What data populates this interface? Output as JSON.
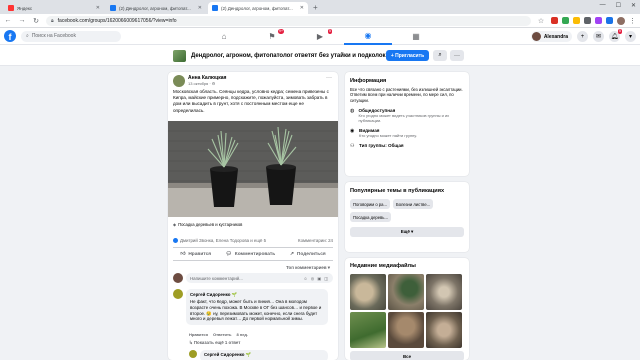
{
  "browser": {
    "tabs": [
      {
        "label": "Яндекс",
        "active": false
      },
      {
        "label": "(2) Дендролог, агроном, фитопат...",
        "active": false
      },
      {
        "label": "(2) Дендролог, агроном, фитопат...",
        "active": true
      }
    ],
    "url": "facebook.com/groups/1620066009617056/?view=info"
  },
  "fb": {
    "search_placeholder": "Поиск на Facebook",
    "user_name": "Alexandra",
    "badges": {
      "pages": "9+",
      "groups": "5",
      "notifications": "5"
    }
  },
  "group": {
    "name": "Дендролог, агроном, фитопатолог ответят без утайки и подколок.",
    "invite_label": "+ Пригласить"
  },
  "post": {
    "author": "Анна Калюцкая",
    "date": "13 октября · ⚙",
    "text": "Московская область. Сеянцы кедра, условно кедра; семена привезены с Кипра, майские примерно, подскажите, пожалуйста, зимовать забрать в дом или высадить в грунт, хотя с постоянным местом еще не определилась.",
    "tag": "Посадка деревьев и кустарников",
    "reactions_text": "Дмитрий Звонка, Елена Тодорова и ещё 5",
    "comments_count": "Комментарии: 24",
    "actions": {
      "like": "Нравится",
      "comment": "Комментировать",
      "share": "Поделиться"
    },
    "sort_label": "Топ комментариев ▾",
    "comment_placeholder": "Напишите комментарий...",
    "comment": {
      "author": "Сергей Сидоренко 🌱",
      "text": "Не факт, что Кедр, может быть и пиния… Она в молодом возрасте очень похожа. В Москве в ОГ без шансов… и первое и второе. 😢 ну, перезимовать может, конечно, если снега будет много и деревья лежат… До первой нормальной зимы."
    },
    "comment_meta": {
      "like": "Нравится",
      "reply": "Ответить",
      "time": "8 нед."
    },
    "show_replies": "↳ Показать ещё 1 ответ",
    "reply_author": "Сергей Сидоренко 🌱"
  },
  "info": {
    "title": "Информация",
    "description": "Все что связано с растениями, без излишней эксалтации. Ответим всем при наличии времени, по мере сил, по ситуации.",
    "rows": [
      {
        "label": "Общедоступная",
        "sub": "Кто угодно может видеть участников группы и их публикации."
      },
      {
        "label": "Видимая",
        "sub": "Кто угодно может найти группу."
      },
      {
        "label": "Тип группы: Общая",
        "sub": ""
      }
    ]
  },
  "topics": {
    "title": "Популярные темы в публикациях",
    "chips": [
      "Поговорим о ра...",
      "Болезни листве...",
      "Посадка деревь..."
    ],
    "more_label": "Ещё ▾"
  },
  "media": {
    "title": "Недавние медиафайлы",
    "more_label": "Все"
  }
}
